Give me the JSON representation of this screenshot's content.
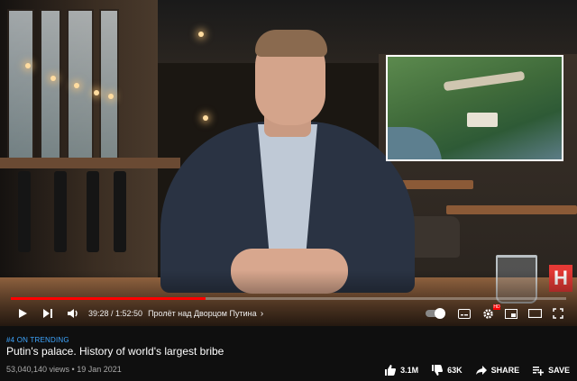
{
  "video": {
    "time": "39:28 / 1:52:50",
    "chapter": "Пролёт над Дворцом Путина",
    "progress": 0.35,
    "channel_logo": "H",
    "autoplay": true
  },
  "info": {
    "trending": "#4 ON TRENDING",
    "title": "Putin's palace. History of world's largest bribe",
    "meta": "53,040,140 views • 19 Jan 2021"
  },
  "actions": {
    "like_count": "3.1M",
    "dislike_count": "63K",
    "share_label": "SHARE",
    "save_label": "SAVE"
  },
  "colors": {
    "accent": "#ff0000",
    "trending": "#3ea6ff",
    "background": "#0f0f0f"
  },
  "icons": {
    "play": "play-icon",
    "next": "next-icon",
    "volume": "volume-icon",
    "chevron": "chevron-right-icon",
    "autoplay": "autoplay-toggle-icon",
    "subtitles": "subtitles-icon",
    "settings": "gear-icon",
    "miniplayer": "miniplayer-icon",
    "theater": "theater-mode-icon",
    "fullscreen": "fullscreen-icon",
    "like": "thumbs-up-icon",
    "dislike": "thumbs-down-icon",
    "share": "share-icon",
    "save": "playlist-add-icon"
  }
}
